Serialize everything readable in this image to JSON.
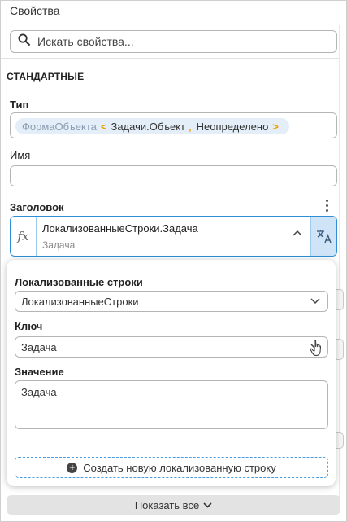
{
  "panel": {
    "title": "Свойства",
    "search": {
      "placeholder": "Искать свойства...",
      "icon": "search-icon"
    },
    "section": "СТАНДАРТНЫЕ"
  },
  "type_field": {
    "label": "Тип",
    "chip": {
      "base": "ФормаОбъекта",
      "arg1": "Задачи.Объект",
      "arg2": "Неопределено"
    }
  },
  "name_field": {
    "label": "Имя",
    "value": ""
  },
  "caption_field": {
    "label": "Заголовок",
    "expression": "ЛокализованныеСтроки.Задача",
    "preview": "Задача",
    "fx_symbol": "fx",
    "chevron": "^",
    "translate_icon": "translate-icon",
    "menu_icon": "kebab-menu-icon"
  },
  "popup": {
    "strings_label": "Локализованные строки",
    "strings_value": "ЛокализованныеСтроки",
    "key_label": "Ключ",
    "key_value": "Задача",
    "value_label": "Значение",
    "value_text": "Задача",
    "create_button": "Создать новую локализованную строку"
  },
  "footer": {
    "show_all": "Показать все"
  },
  "colors": {
    "accent": "#2f8fd6",
    "chip_bg": "#e3eef9",
    "chip_bracket": "#f0a000",
    "translate_bg": "#cfe4f6"
  }
}
